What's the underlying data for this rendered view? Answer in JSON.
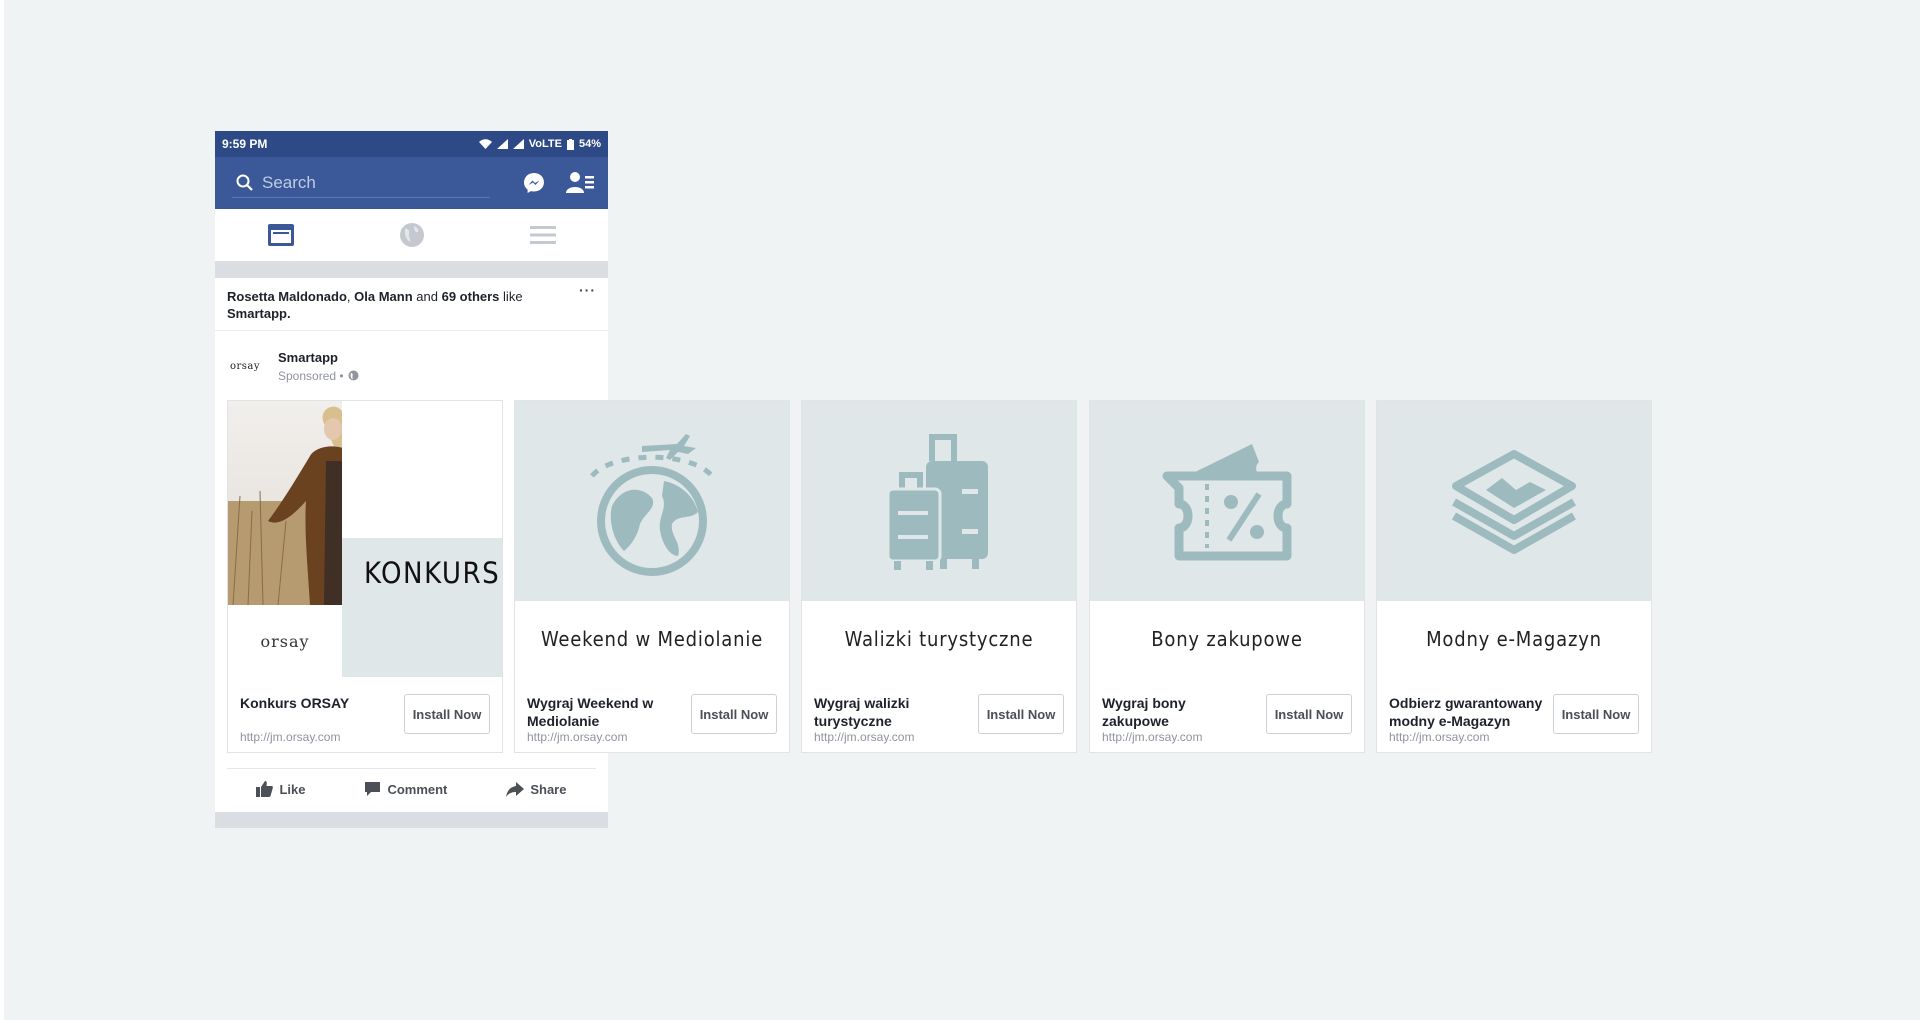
{
  "status_bar": {
    "time": "9:59 PM",
    "network": "VoLTE",
    "battery": "54%"
  },
  "search": {
    "placeholder": "Search"
  },
  "post": {
    "likers": [
      "Rosetta Maldonado",
      "Ola Mann"
    ],
    "and_text": "and",
    "others": "69 others",
    "like_text": "like",
    "page": "Smartapp.",
    "more": "···",
    "author": "Smartapp",
    "author_logo": "orsay",
    "sponsored": "Sponsored •"
  },
  "cards": [
    {
      "image_logo": "orsay",
      "image_text": "KONKURS",
      "title": "Konkurs ORSAY",
      "url": "http://jm.orsay.com",
      "button": "Install Now"
    },
    {
      "icon": "globe-plane-icon",
      "caption": "Weekend w Mediolanie",
      "title": "Wygraj Weekend w Mediolanie",
      "url": "http://jm.orsay.com",
      "button": "Install Now"
    },
    {
      "icon": "suitcase-icon",
      "caption": "Walizki turystyczne",
      "title": "Wygraj walizki turystyczne",
      "url": "http://jm.orsay.com",
      "button": "Install Now"
    },
    {
      "icon": "ticket-percent-icon",
      "caption": "Bony zakupowe",
      "title": "Wygraj bony zakupowe",
      "url": "http://jm.orsay.com",
      "button": "Install Now"
    },
    {
      "icon": "stacked-layers-icon",
      "caption": "Modny e-Magazyn",
      "title": "Odbierz gwarantowany modny e-Magazyn",
      "url": "http://jm.orsay.com",
      "button": "Install Now"
    }
  ],
  "actions": {
    "like": "Like",
    "comment": "Comment",
    "share": "Share"
  },
  "colors": {
    "fb_blue": "#3b5998",
    "status_blue": "#2e4a86",
    "icon_teal": "#9dbbbf",
    "card_bg": "#dfe7e9",
    "page_bg": "#eff3f4"
  }
}
